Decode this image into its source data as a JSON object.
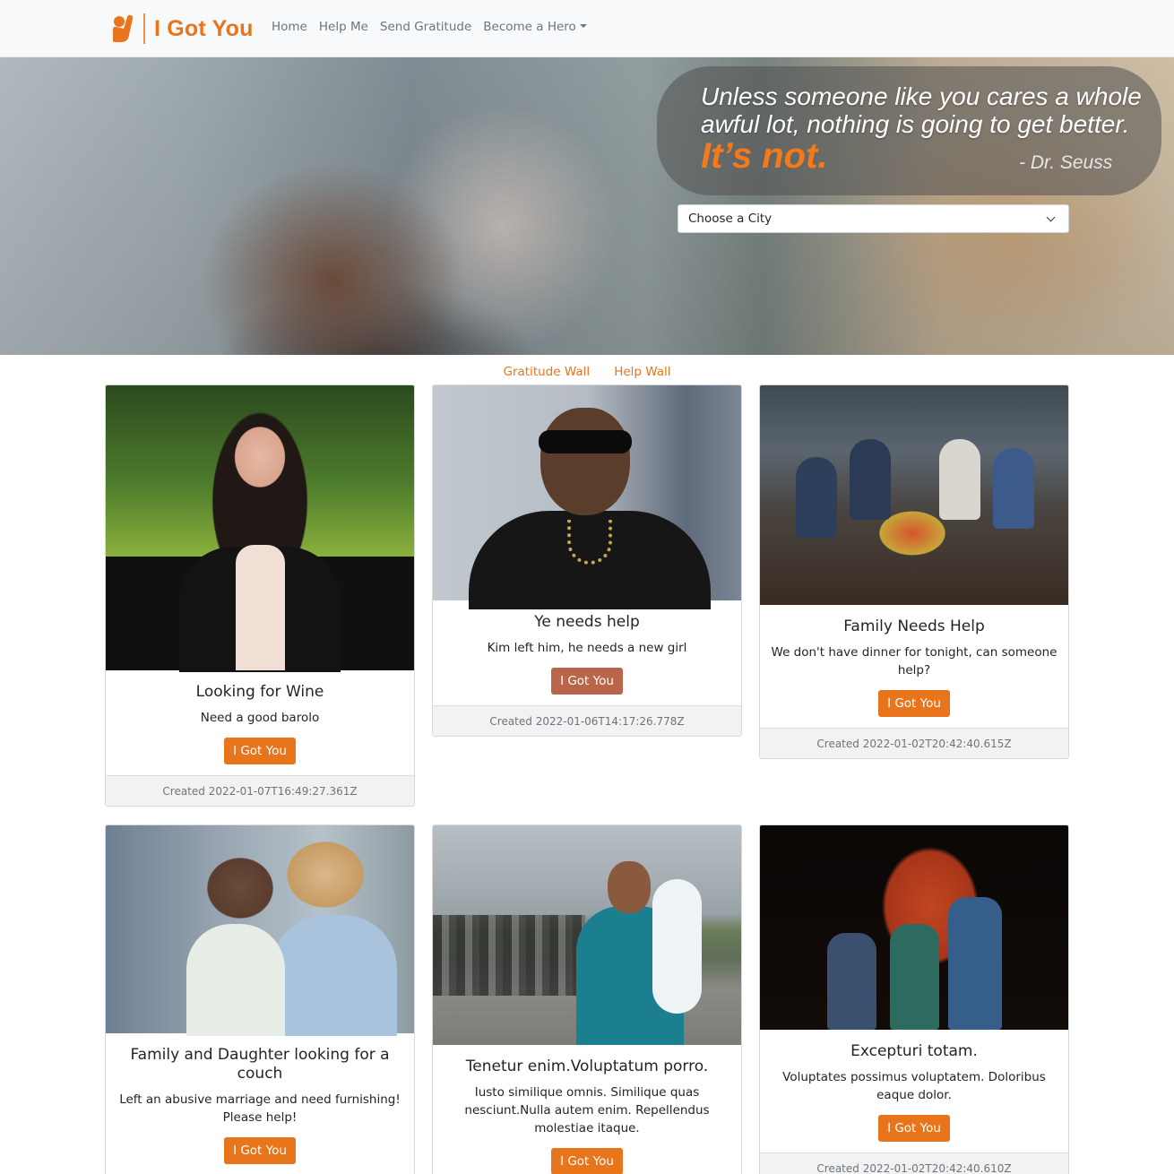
{
  "brand": {
    "name": "I Got You",
    "color": "#e8741c"
  },
  "nav": {
    "items": [
      "Home",
      "Help Me",
      "Send Gratitude",
      "Become a Hero"
    ]
  },
  "hero": {
    "quote_line1": "Unless someone like you cares a whole",
    "quote_line2": "awful lot, nothing is going to get better.",
    "quote_emphasis": "It’s not.",
    "quote_author": "- Dr. Seuss",
    "city_select": {
      "selected": "Choose a City"
    }
  },
  "walls": {
    "tabs": [
      "Gratitude Wall",
      "Help Wall"
    ]
  },
  "cards": [
    {
      "title": "Looking for Wine",
      "text": "Need a good barolo",
      "button": "I Got You",
      "footer": "Created 2022-01-07T16:49:27.361Z"
    },
    {
      "title": "Ye needs help",
      "text": "Kim left him, he needs a new girl",
      "button": "I Got You",
      "footer": "Created 2022-01-06T14:17:26.778Z"
    },
    {
      "title": "Family Needs Help",
      "text": "We don't have dinner for tonight, can someone help?",
      "button": "I Got You",
      "footer": "Created 2022-01-02T20:42:40.615Z"
    },
    {
      "title": "Family and Daughter looking for a couch",
      "text": "Left an abusive marriage and need furnishing! Please help!",
      "button": "I Got You",
      "footer": ""
    },
    {
      "title": "Tenetur enim.Voluptatum porro.",
      "text": "Iusto similique omnis. Similique quas nesciunt.Nulla autem enim. Repellendus molestiae itaque.",
      "button": "I Got You",
      "footer": ""
    },
    {
      "title": "Excepturi totam.",
      "text": "Voluptates possimus voluptatem. Doloribus eaque dolor.",
      "button": "I Got You",
      "footer": "Created 2022-01-02T20:42:40.610Z"
    }
  ]
}
